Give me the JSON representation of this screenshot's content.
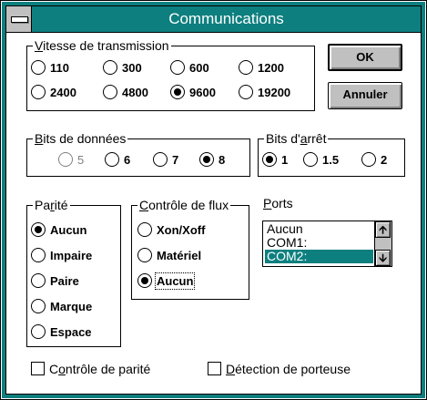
{
  "window": {
    "title": "Communications"
  },
  "speed": {
    "label_pre": "",
    "label_ul": "V",
    "label_post": "itesse de transmission",
    "options": [
      "110",
      "300",
      "600",
      "1200",
      "2400",
      "4800",
      "9600",
      "19200"
    ],
    "selected": "9600"
  },
  "buttons": {
    "ok": "OK",
    "cancel": "Annuler"
  },
  "data_bits": {
    "label_ul": "B",
    "label_post": "its de données",
    "options": [
      "5",
      "6",
      "7",
      "8"
    ],
    "selected": "8",
    "disabled": [
      "5"
    ]
  },
  "stop_bits": {
    "label_pre": "Bits d'",
    "label_ul": "a",
    "label_post": "rrêt",
    "options": [
      "1",
      "1.5",
      "2"
    ],
    "selected": "1"
  },
  "parity": {
    "label_pre": "Pa",
    "label_ul": "r",
    "label_post": "ité",
    "options": [
      "Aucun",
      "Impaire",
      "Paire",
      "Marque",
      "Espace"
    ],
    "selected": "Aucun"
  },
  "flow": {
    "label_ul": "C",
    "label_post": "ontrôle de flux",
    "options": [
      "Xon/Xoff",
      "Matériel",
      "Aucun"
    ],
    "selected": "Aucun"
  },
  "ports": {
    "label_ul": "P",
    "label_post": "orts",
    "items": [
      "Aucun",
      "COM1:",
      "COM2:"
    ],
    "selected": "COM2:"
  },
  "checks": {
    "parity_pre": "C",
    "parity_ul": "o",
    "parity_post": "ntrôle de parité",
    "carrier_ul": "D",
    "carrier_post": "étection de porteuse"
  },
  "icons": {
    "system_menu": "system-menu-icon",
    "up": "arrow-up-icon",
    "down": "arrow-down-icon"
  },
  "colors": {
    "title_bar": "#0e7f7f",
    "selection": "#0e7f7f"
  }
}
